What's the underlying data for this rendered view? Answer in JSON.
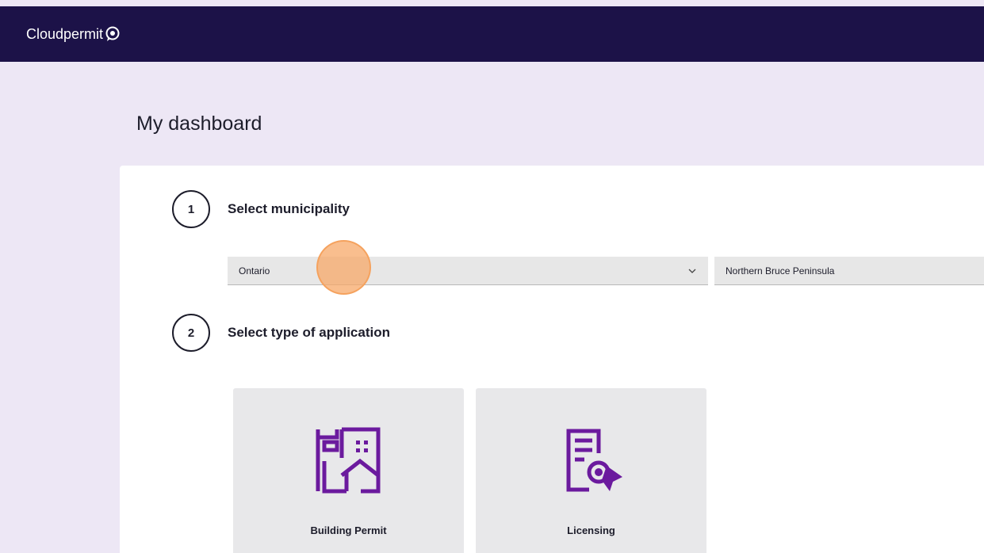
{
  "app": {
    "brand": "Cloudpermit"
  },
  "page": {
    "title": "My dashboard"
  },
  "steps": [
    {
      "number": "1",
      "title": "Select municipality"
    },
    {
      "number": "2",
      "title": "Select type of application"
    }
  ],
  "municipality": {
    "province": "Ontario",
    "municipality": "Northern Bruce Peninsula"
  },
  "application_types": [
    {
      "label": "Building Permit",
      "icon": "building-icon"
    },
    {
      "label": "Licensing",
      "icon": "certificate-icon"
    }
  ],
  "colors": {
    "topbar": "#1c1248",
    "background": "#ede7f5",
    "icon_purple": "#6b1a9e",
    "click_indicator": "#f7a868"
  }
}
